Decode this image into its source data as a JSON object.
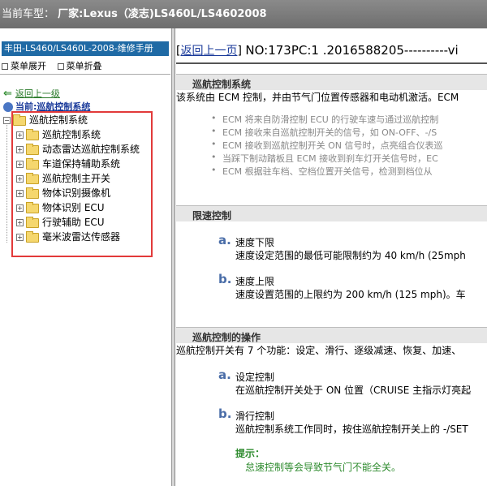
{
  "titlebar": {
    "prefix": "当前车型：",
    "model": "厂家:Lexus（凌志)LS460L/LS4602008"
  },
  "sidebar": {
    "manual_title": "丰田-LS460/LS460L-2008-维修手册",
    "menu_expand": "菜单展开",
    "menu_collapse": "菜单折叠",
    "back_link": "返回上一级",
    "current_label": "当前:",
    "current_value": "巡航控制系统",
    "tree": {
      "root": "巡航控制系统",
      "items": [
        {
          "label": "巡航控制系统"
        },
        {
          "label": "动态雷达巡航控制系统"
        },
        {
          "label": "车道保持辅助系统"
        },
        {
          "label": "巡航控制主开关"
        },
        {
          "label": "物体识别摄像机"
        },
        {
          "label": "物体识别 ECU"
        },
        {
          "label": "行驶辅助 ECU"
        },
        {
          "label": "毫米波雷达传感器"
        }
      ]
    }
  },
  "main": {
    "back_link": "返回上一页",
    "doc_number": "NO:173PC:1 .2016588205----------vi",
    "section1": {
      "title": "巡航控制系统",
      "intro": "该系统由 ECM 控制，并由节气门位置传感器和电动机激活。ECM",
      "bullets": [
        "ECM 将来自防滑控制 ECU 的行驶车速与通过巡航控制",
        "ECM 接收来自巡航控制开关的信号，如 ON-OFF、-/S",
        "ECM 接收到巡航控制开关 ON 信号时，点亮组合仪表巡",
        "当踩下制动踏板且 ECM 接收到刹车灯开关信号时，EC",
        "ECM 根据驻车档、空档位置开关信号，检测到档位从"
      ]
    },
    "section2": {
      "title": "限速控制",
      "items": [
        {
          "letter": "a.",
          "title": "速度下限",
          "desc": "速度设定范围的最低可能限制约为 40 km/h (25mph"
        },
        {
          "letter": "b.",
          "title": "速度上限",
          "desc": "速度设置范围的上限约为 200 km/h (125 mph)。车"
        }
      ]
    },
    "section3": {
      "title": "巡航控制的操作",
      "intro": "巡航控制开关有 7 个功能：设定、滑行、逐级减速、恢复、加速、",
      "items": [
        {
          "letter": "a.",
          "title": "设定控制",
          "desc": "在巡航控制开关处于 ON 位置（CRUISE 主指示灯亮起"
        },
        {
          "letter": "b.",
          "title": "滑行控制",
          "desc": "巡航控制系统工作同时，按住巡航控制开关上的 -/SET"
        }
      ],
      "tip_title": "提示：",
      "tip_desc": "怠速控制等会导致节气门不能全关。"
    }
  },
  "colors": {
    "titlebar": "#7a7a7a",
    "manual_title_bg": "#1f6aa5",
    "highlight_border": "#e23a3a",
    "section_bg": "#e6e6e6",
    "letter_color": "#4a6da8",
    "tip_color": "#2e8b2e"
  }
}
